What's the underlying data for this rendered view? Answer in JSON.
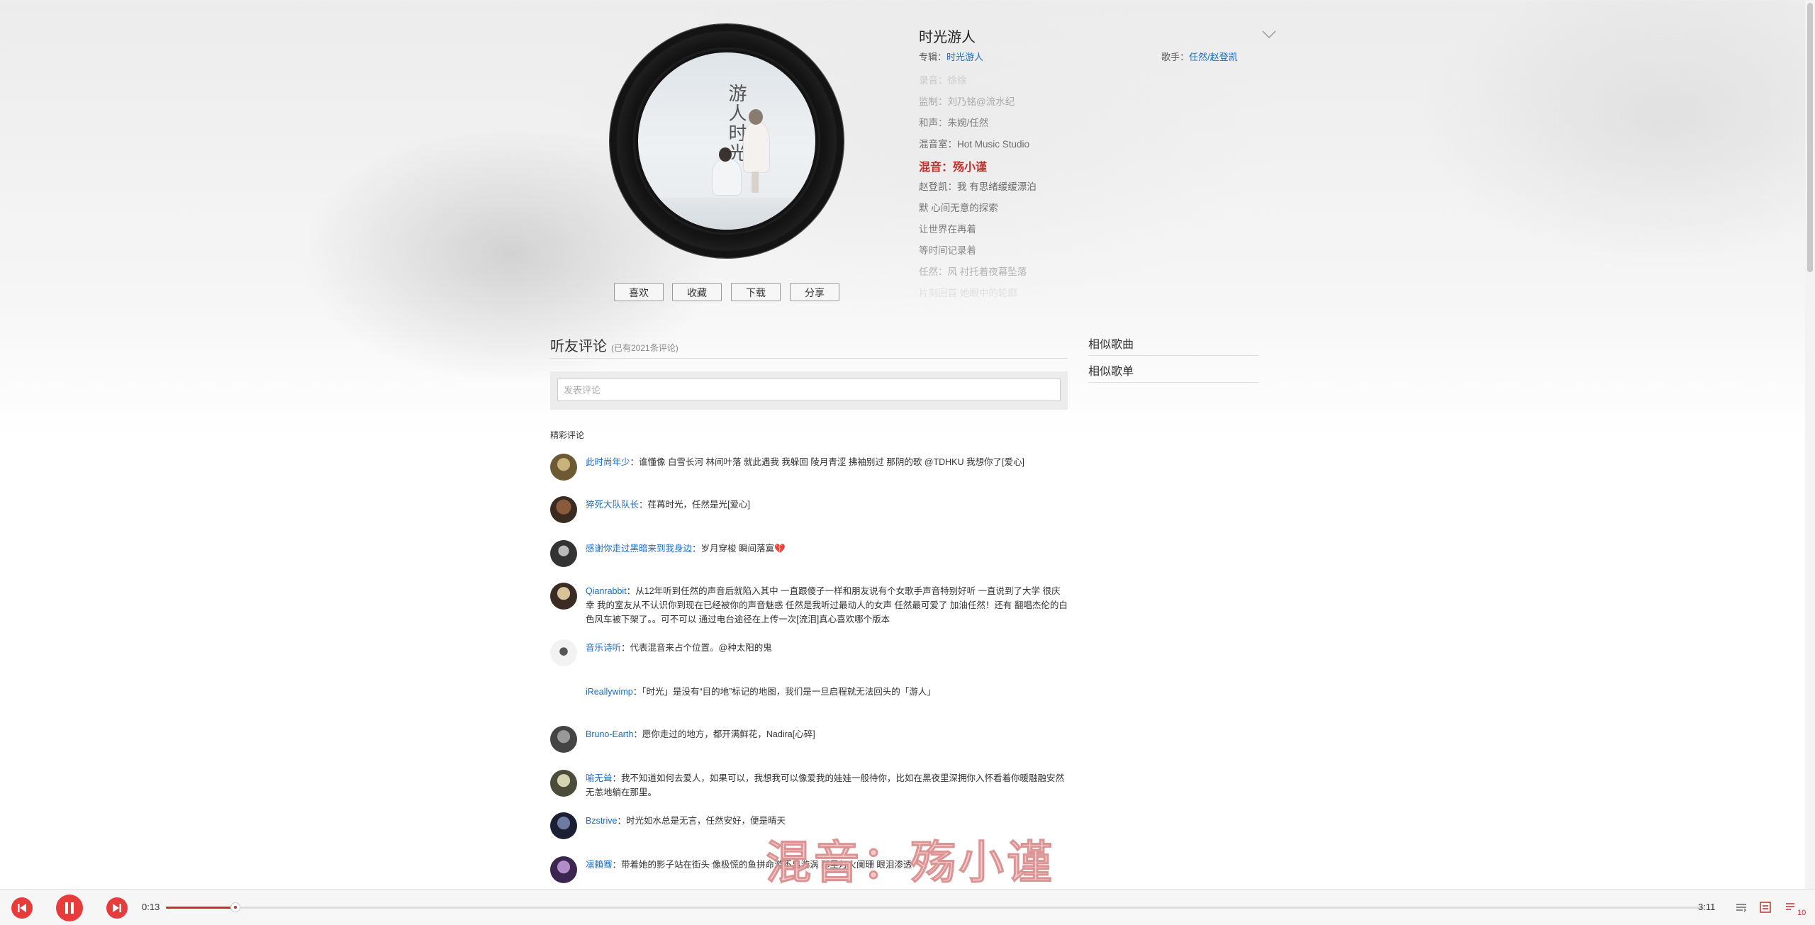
{
  "song": {
    "title": "时光游人",
    "album_label": "专辑：",
    "album": "时光游人",
    "artist_label": "歌手：",
    "artist": "任然/赵登凯"
  },
  "actions": {
    "like": "喜欢",
    "collect": "收藏",
    "download": "下载",
    "share": "分享"
  },
  "lyrics": [
    "录音：徐徐",
    "监制：刘乃铭@流水纪",
    "和声：朱婉/任然",
    "混音室：Hot Music Studio",
    "混音：殇小谨",
    "赵登凯：我 有思绪缓缓漂泊",
    "默 心间无意的探索",
    "让世界在再着",
    "等时间记录着",
    "任然：风 衬托着夜幕坠落",
    "片刻回首 她眼中的轮廓"
  ],
  "active_lyric_index": 4,
  "comments": {
    "title": "听友评论",
    "count_text": "(已有2021条评论)",
    "input_placeholder": "发表评论",
    "featured_label": "精彩评论",
    "items": [
      {
        "user": "此时尚年少",
        "text": "：谁懂像 白雪长河 林间叶落 就此遇我 我躲回 陵月青涩 拂袖别过 那阴的歌 @TDHKU 我想你了[爱心]"
      },
      {
        "user": "猝死大队队长",
        "text": "：荏苒时光，任然是光[爱心]"
      },
      {
        "user": "感谢你走过黑暗来到我身边",
        "text": "：岁月穿梭 瞬间落寞💔"
      },
      {
        "user": "Qianrabbit",
        "text": "：从12年听到任然的声音后就陷入其中 一直跟傻子一样和朋友说有个女歌手声音特别好听 一直说到了大学 很庆幸 我的室友从不认识你到现在已经被你的声音魅惑 任然是我听过最动人的女声 任然最可爱了 加油任然！还有 翻唱杰伦的白色风车被下架了。。可不可以 通过电台途径在上传一次[流泪]真心喜欢哪个版本"
      },
      {
        "user": "音乐诗听",
        "text": "：代表混音来占个位置。@种太阳的鬼"
      },
      {
        "user": "iReallywimp",
        "text": "：「时光」是没有“目的地”标记的地图，我们是一旦启程就无法回头的「游人」"
      },
      {
        "user": "Bruno-Earth",
        "text": "：愿你走过的地方，都开满鲜花，Nadira[心碎]"
      },
      {
        "user": "喻无耸",
        "text": "：我不知道如何去爱人，如果可以，我想我可以像爱我的娃娃一般待你，比如在黑夜里深拥你入怀看着你暖融融安然无恙地躺在那里。"
      },
      {
        "user": "Bzstrive",
        "text": "：时光如水总是无言，任然安好，便是晴天"
      },
      {
        "user": "凛賴骞",
        "text": "：带着她的影子站在街头 像极慌的鱼拼命游不出漩涡 那里灯火阑珊 眼泪渗透"
      }
    ]
  },
  "similar": {
    "songs_title": "相似歌曲",
    "playlists_title": "相似歌单"
  },
  "overlay_lyric": "混音：殇小谨",
  "player": {
    "current_time": "0:13",
    "total_time": "3:11",
    "progress_fraction": 0.045,
    "playlist_count": "10",
    "accent_color": "#e83c3c"
  }
}
